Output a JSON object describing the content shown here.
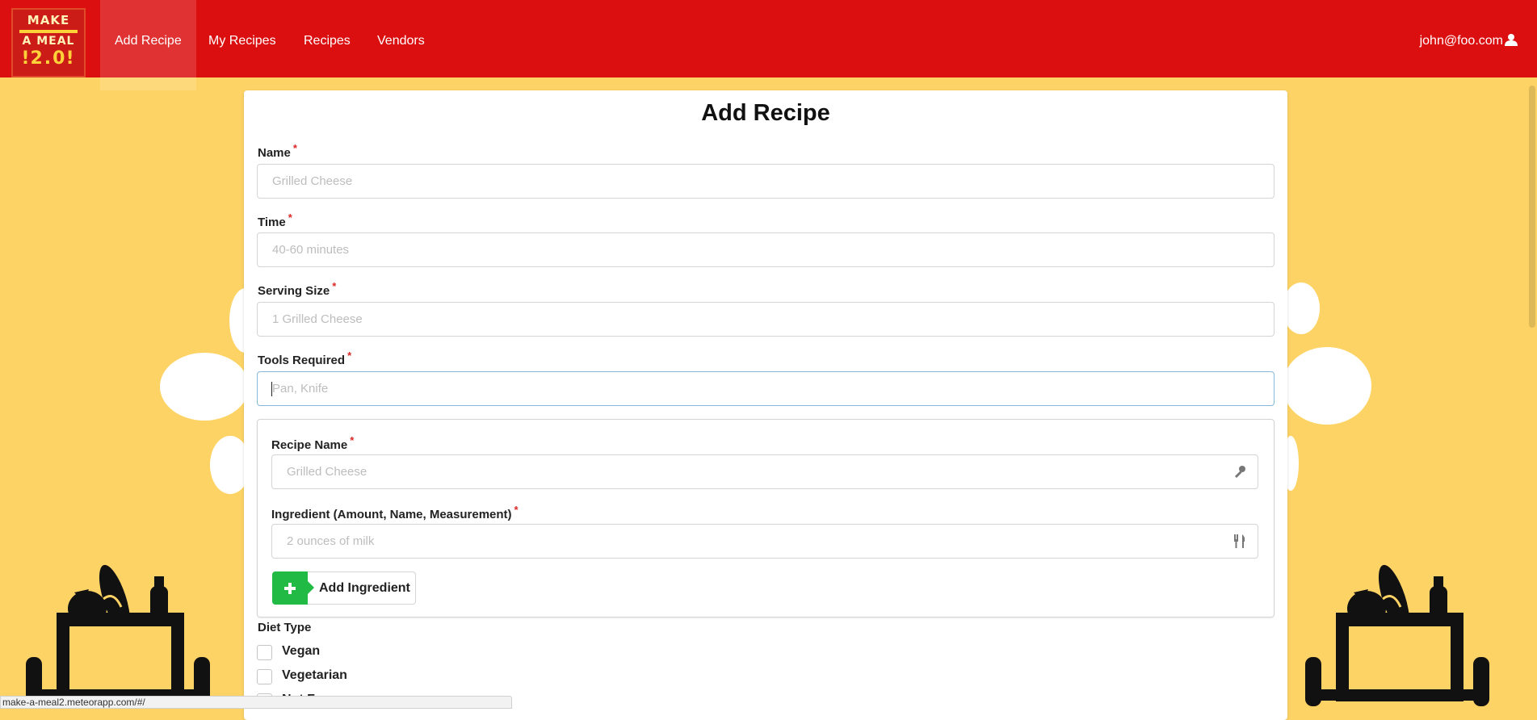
{
  "navbar": {
    "logo_line1": "MAKE",
    "logo_line2": "A MEAL",
    "logo_line3": "2.0",
    "items": [
      {
        "label": "Add Recipe",
        "active": true
      },
      {
        "label": "My Recipes"
      },
      {
        "label": "Recipes"
      },
      {
        "label": "Vendors"
      }
    ],
    "user_email": "john@foo.com",
    "user_icon": "user-icon"
  },
  "form": {
    "title": "Add Recipe",
    "required_mark": "*",
    "name": {
      "label": "Name",
      "placeholder": "Grilled Cheese"
    },
    "time": {
      "label": "Time",
      "placeholder": "40-60 minutes"
    },
    "serving_size": {
      "label": "Serving Size",
      "placeholder": "1 Grilled Cheese"
    },
    "tools": {
      "label": "Tools Required",
      "placeholder": "Pan, Knife"
    },
    "ingredient_section": {
      "recipe_name": {
        "label": "Recipe Name",
        "placeholder": "Grilled Cheese",
        "icon": "key-icon"
      },
      "ingredient": {
        "label": "Ingredient (Amount, Name, Measurement)",
        "placeholder": "2 ounces of milk",
        "icon": "utensils-icon"
      },
      "add_button": {
        "label": "Add Ingredient",
        "icon": "plus-icon"
      }
    },
    "diet_type": {
      "label": "Diet Type",
      "options": [
        {
          "label": "Vegan",
          "checked": false
        },
        {
          "label": "Vegetarian",
          "checked": false
        },
        {
          "label": "Nut Free",
          "checked": false
        }
      ]
    }
  },
  "status_bar": {
    "url": "make-a-meal2.meteorapp.com/#/"
  },
  "colors": {
    "navbar": "#db0f0f",
    "background": "#fdd365",
    "add_button": "#21ba45",
    "required": "#db2828"
  }
}
